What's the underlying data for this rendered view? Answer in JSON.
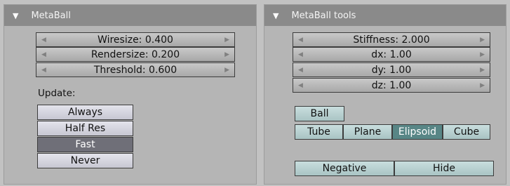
{
  "metaball_panel": {
    "title": "MetaBall",
    "fields": [
      {
        "label": "Wiresize: 0.400"
      },
      {
        "label": "Rendersize: 0.200"
      },
      {
        "label": "Threshold: 0.600"
      }
    ],
    "update_label": "Update:",
    "update_options": [
      "Always",
      "Half Res",
      "Fast",
      "Never"
    ],
    "update_selected": "Fast"
  },
  "tools_panel": {
    "title": "MetaBall tools",
    "fields": [
      {
        "label": "Stiffness: 2.000"
      },
      {
        "label": "dx: 1.00"
      },
      {
        "label": "dy: 1.00"
      },
      {
        "label": "dz: 1.00"
      }
    ],
    "ball_label": "Ball",
    "types": [
      "Tube",
      "Plane",
      "Elipsoid",
      "Cube"
    ],
    "type_selected": "Elipsoid",
    "negative_label": "Negative",
    "hide_label": "Hide"
  },
  "icons": {
    "collapse": "triangle-down-icon",
    "decrement": "arrow-left-icon",
    "increment": "arrow-right-icon"
  },
  "colors": {
    "header_bg": "#8a8a8a",
    "panel_bg": "#b5b5b5",
    "active_update": "#6f6f78",
    "active_type": "#588686"
  }
}
